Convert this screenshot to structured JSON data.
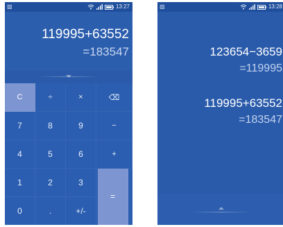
{
  "left_screen": {
    "status_time": "13:27",
    "expression": "119995+63552",
    "result": "=183547",
    "keys": [
      {
        "label": "C",
        "name": "clear-key"
      },
      {
        "label": "÷",
        "name": "divide-key"
      },
      {
        "label": "×",
        "name": "multiply-key"
      },
      {
        "label": "⌫",
        "name": "backspace-key"
      },
      {
        "label": "7",
        "name": "digit-7-key"
      },
      {
        "label": "8",
        "name": "digit-8-key"
      },
      {
        "label": "9",
        "name": "digit-9-key"
      },
      {
        "label": "−",
        "name": "minus-key"
      },
      {
        "label": "4",
        "name": "digit-4-key"
      },
      {
        "label": "5",
        "name": "digit-5-key"
      },
      {
        "label": "6",
        "name": "digit-6-key"
      },
      {
        "label": "+",
        "name": "plus-key"
      },
      {
        "label": "1",
        "name": "digit-1-key"
      },
      {
        "label": "2",
        "name": "digit-2-key"
      },
      {
        "label": "3",
        "name": "digit-3-key"
      },
      {
        "label": "=",
        "name": "equals-key"
      },
      {
        "label": "0",
        "name": "digit-0-key"
      },
      {
        "label": ".",
        "name": "decimal-key"
      },
      {
        "label": "+/-",
        "name": "sign-toggle-key"
      }
    ]
  },
  "right_screen": {
    "status_time": "13:28",
    "history": [
      {
        "expression": "123654−3659",
        "result": "=119995"
      },
      {
        "expression": "119995+63552",
        "result": "=183547"
      }
    ]
  },
  "icons": {
    "gallery": "image-icon",
    "wifi": "wifi-icon",
    "signal": "signal-icon",
    "battery": "battery-icon"
  },
  "colors": {
    "background": "#2a5bab",
    "accent_key": "#7d95d0",
    "status_bar": "#1f4f9c"
  }
}
